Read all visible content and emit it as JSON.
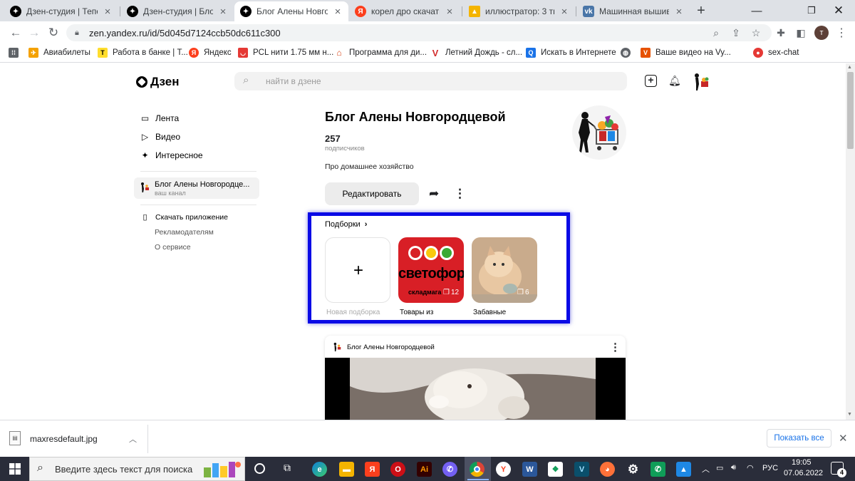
{
  "tabs": [
    {
      "title": "Дзен-студия | Теперь",
      "active": false
    },
    {
      "title": "Дзен-студия | Блог Ал",
      "active": false
    },
    {
      "title": "Блог Алены Новгоро",
      "active": true
    },
    {
      "title": "корел дро скачать —",
      "active": false
    },
    {
      "title": "иллюстратор: 3 тыс и",
      "active": false
    },
    {
      "title": "Машинная вышивка",
      "active": false
    }
  ],
  "new_tab_symbol": "+",
  "address": {
    "url": "zen.yandex.ru/id/5d045d7124ccb50dc611c300",
    "profile_initial": "т"
  },
  "bookmarks": [
    {
      "label": "Авиабилеты",
      "icon": "airplane-icon",
      "color": "#f4a100"
    },
    {
      "label": "Работа в банке | Т...",
      "icon": "tinkoff-icon",
      "color": "#ffdd2d"
    },
    {
      "label": "Яндекс",
      "icon": "yandex-icon",
      "color": "#fc3f1d"
    },
    {
      "label": "PCL нити 1.75 мм н...",
      "icon": "shop-icon",
      "color": "#e53935"
    },
    {
      "label": "Программа для ди...",
      "icon": "house-icon",
      "color": "#d84315"
    },
    {
      "label": "Летний Дождь - сл...",
      "icon": "v-icon",
      "color": "#d32f2f"
    },
    {
      "label": "Искать в Интернете",
      "icon": "search-icon",
      "color": "#1a73e8"
    },
    {
      "label": "",
      "icon": "globe-icon",
      "color": "#5f6368"
    },
    {
      "label": "Ваше видео на Vy...",
      "icon": "v-icon",
      "color": "#e65100"
    },
    {
      "label": "sex-chat",
      "icon": "ok-icon",
      "color": "#e53935"
    }
  ],
  "zen": {
    "logo": "Дзен",
    "search_placeholder": "найти в дзене",
    "sidebar": {
      "items": [
        "Лента",
        "Видео",
        "Интересное"
      ],
      "channel_name": "Блог Алены Новгородце...",
      "channel_sub": "ваш канал",
      "download_app": "Скачать приложение",
      "advertisers": "Рекламодателям",
      "about": "О сервисе"
    },
    "channel": {
      "title": "Блог Алены Новгородцевой",
      "subscribers": "257",
      "subscribers_label": "подписчиков",
      "description": "Про домашнее хозяйство",
      "edit_button": "Редактировать"
    },
    "collections": {
      "header": "Подборки",
      "items": [
        {
          "label": "Новая подборка",
          "count": "",
          "kind": "new",
          "symbol": "+"
        },
        {
          "label": "Товары из",
          "count": "12",
          "kind": "svetofor",
          "logo_text": "светофор",
          "small_text": "складмага"
        },
        {
          "label": "Забавные",
          "count": "6",
          "kind": "kitten"
        }
      ]
    },
    "feed": {
      "author": "Блог Алены Новгородцевой"
    }
  },
  "download": {
    "filename": "maxresdefault.jpg",
    "show_all": "Показать все"
  },
  "taskbar": {
    "search_placeholder": "Введите здесь текст для поиска",
    "lang": "РУС",
    "time": "19:05",
    "date": "07.06.2022",
    "notifications": "4"
  }
}
